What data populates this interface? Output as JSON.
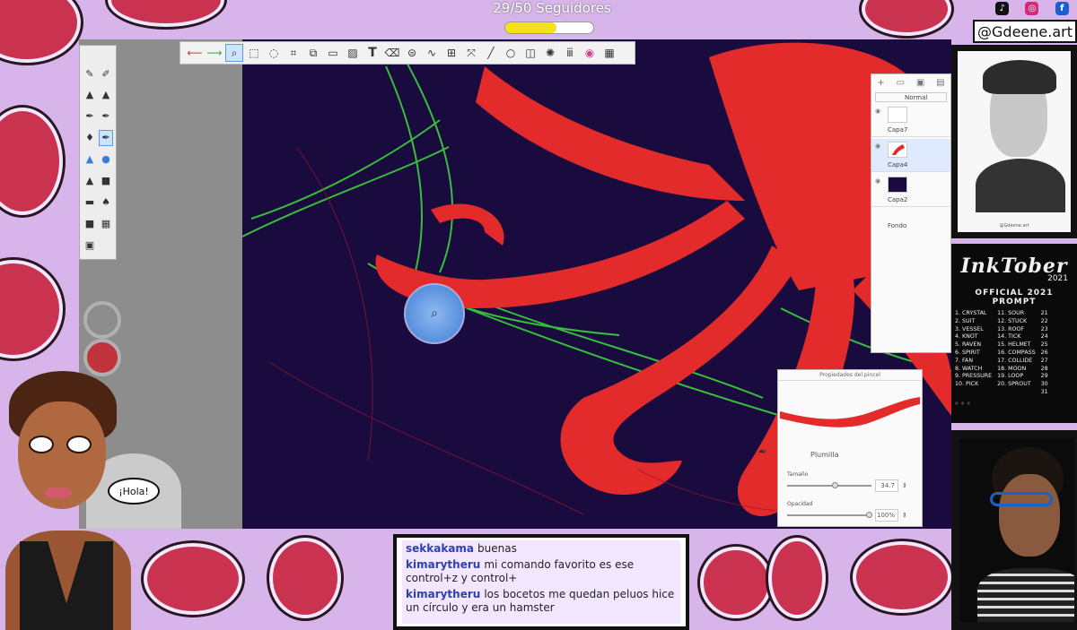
{
  "header": {
    "followers_text": "29/50 Seguidores",
    "followers_current": 29,
    "followers_goal": 50
  },
  "socials": {
    "handle": "@Gdeene.art",
    "icons": [
      "tiktok-icon",
      "instagram-icon",
      "facebook-icon"
    ]
  },
  "colors": {
    "accent_purple": "#d7b5ea",
    "canvas_bg": "#1a0b3e",
    "squid_red": "#e32b2b",
    "goal_yellow": "#f3e21a"
  },
  "toolbar": {
    "icons": [
      "undo-icon",
      "redo-icon",
      "zoom-icon",
      "select-icon",
      "lasso-icon",
      "crop-icon",
      "transform-icon",
      "ruler-icon",
      "fill-icon",
      "text-icon",
      "eraser-icon",
      "symmetry-icon",
      "curve-icon",
      "grid-icon",
      "warp-icon",
      "line-icon",
      "ellipse-icon",
      "shape-icon",
      "pattern-icon",
      "color-wheel-icon",
      "layers-icon"
    ]
  },
  "layers_panel": {
    "blend_mode": "Normal",
    "layers": [
      {
        "name": "Capa7",
        "selected": false
      },
      {
        "name": "Capa4",
        "selected": true
      },
      {
        "name": "Capa2",
        "selected": false
      },
      {
        "name": "Fondo",
        "selected": false
      }
    ]
  },
  "brush_props": {
    "title": "Propiedades del pincel",
    "brush_name": "Plumilla",
    "size_label": "Tamaño",
    "size_value": "34.7",
    "opacity_label": "Opacidad",
    "opacity_value": "100%"
  },
  "inktober": {
    "logo": "InkTober",
    "year": "2021",
    "title": "OFFICIAL 2021 PROMPT",
    "col1": [
      "1. CRYSTAL",
      "2. SUIT",
      "3. VESSEL",
      "4. KNOT",
      "5. RAVEN",
      "6. SPIRIT",
      "7. FAN",
      "8. WATCH",
      "9. PRESSURE",
      "10. PICK"
    ],
    "col2": [
      "11. SOUR",
      "12. STUCK",
      "13. ROOF",
      "14. TICK",
      "15. HELMET",
      "16. COMPASS",
      "17. COLLIDE",
      "18. MOON",
      "19. LOOP",
      "20. SPROUT"
    ],
    "col3": [
      "21",
      "22",
      "23",
      "24",
      "25",
      "26",
      "27",
      "28",
      "29",
      "30",
      "31"
    ]
  },
  "frida": {
    "caption": "@Gdeene.art"
  },
  "avatar": {
    "speech": "¡Hola!"
  },
  "chat": {
    "messages": [
      {
        "user": "sekkakama",
        "text": "buenas"
      },
      {
        "user": "kimarytheru",
        "text": "mi comando favorito es ese control+z y control+"
      },
      {
        "user": "kimarytheru",
        "text": "los bocetos me quedan peluos hice un círculo y era un hamster"
      }
    ]
  }
}
